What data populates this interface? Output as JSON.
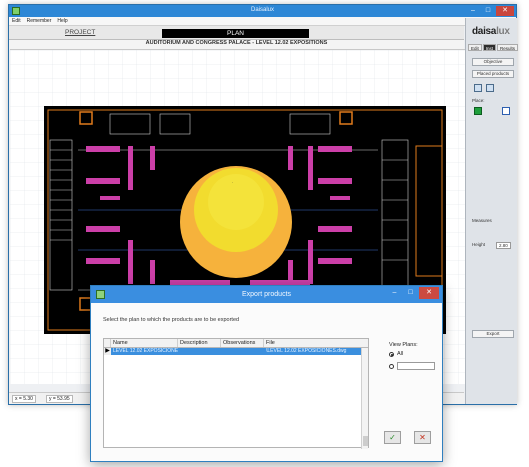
{
  "window": {
    "title": "Daisalux",
    "min_glyph": "–",
    "max_glyph": "□",
    "close_glyph": "✕"
  },
  "menu": [
    "Edit",
    "Remember",
    "Help"
  ],
  "tabs": {
    "project": "PROJECT",
    "plan": "PLAN"
  },
  "drawing": {
    "title": "AUDITORIUM AND CONGRESS PALACE - LEVEL 12.02 EXPOSITIONS"
  },
  "statusbar": {
    "x": "x = 5.30",
    "y": "y = 53.95"
  },
  "sidepanel": {
    "logo_main": "daisa",
    "logo_accent": "lux",
    "tabs": [
      "Edit",
      "Inst",
      "Results"
    ],
    "objective_btn": "Objective",
    "placed_products_btn": "Placed products",
    "place_label": "Place:",
    "measures_label": "Measures",
    "height_label": "Height",
    "height_value": "2.80",
    "export_btn": "Export"
  },
  "dialog": {
    "title": "Export products",
    "instruction": "Select the plan to which the products are to be exported",
    "columns": [
      "Name",
      "Description",
      "Observations",
      "File"
    ],
    "rows": [
      {
        "selector": "▶",
        "name": "LEVEL 12.02 EXPOSICIONES",
        "description": "",
        "observations": "",
        "file": "\\LEVEL 12.02 EXPOSICIONES.dwg"
      }
    ],
    "view_plans_label": "View Plans:",
    "radio_all_label": "All",
    "ok_glyph": "✓",
    "cancel_glyph": "✕",
    "colors": {
      "titlebar": "#3a8ee0",
      "selected_row": "#3b8fde"
    }
  }
}
